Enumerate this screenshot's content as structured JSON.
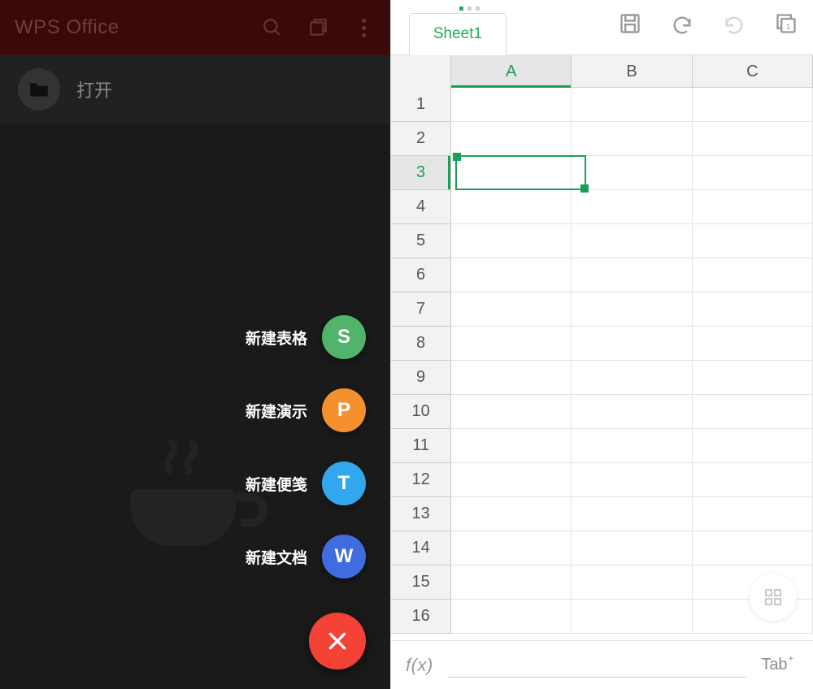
{
  "left": {
    "app_title": "WPS Office",
    "open_label": "打开",
    "fab_items": [
      {
        "label": "新建表格",
        "glyph": "S",
        "color_class": "fab-green"
      },
      {
        "label": "新建演示",
        "glyph": "P",
        "color_class": "fab-orange"
      },
      {
        "label": "新建便笺",
        "glyph": "T",
        "color_class": "fab-blue"
      },
      {
        "label": "新建文档",
        "glyph": "W",
        "color_class": "fab-indigo"
      }
    ]
  },
  "right": {
    "sheet_tab": "Sheet1",
    "columns": [
      "A",
      "B",
      "C"
    ],
    "rows_visible": [
      "1",
      "2",
      "3",
      "4",
      "5",
      "6",
      "7",
      "8",
      "9",
      "10",
      "11",
      "12",
      "13",
      "14",
      "15",
      "16"
    ],
    "selected_col_index": 0,
    "selected_row_index": 2,
    "formula_label": "f(x)",
    "tab_label": "Tab"
  },
  "colors": {
    "accent_green": "#18a056",
    "fab_red": "#f44336"
  }
}
